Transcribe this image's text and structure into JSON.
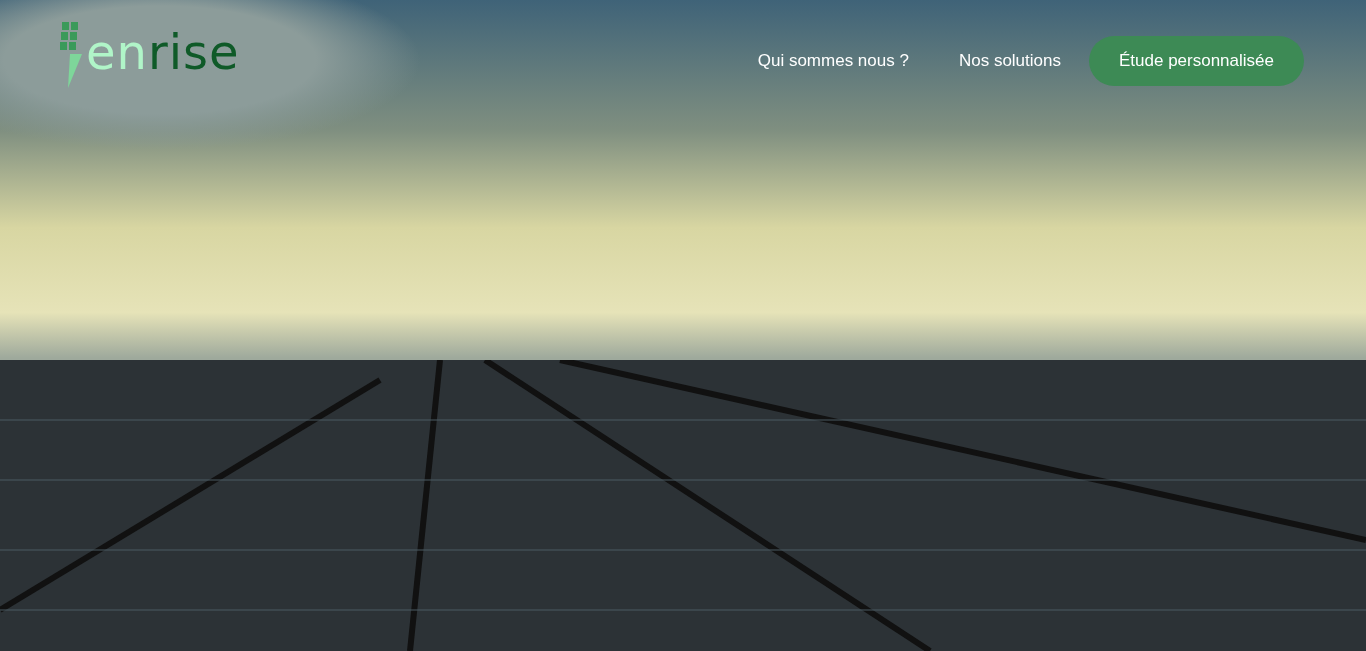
{
  "logo": {
    "text_light": "en",
    "text_dark": "rise"
  },
  "nav": {
    "links": [
      {
        "label": "Qui sommes nous ?"
      },
      {
        "label": "Nos solutions"
      }
    ],
    "cta": {
      "label": "Étude personnalisée"
    }
  }
}
